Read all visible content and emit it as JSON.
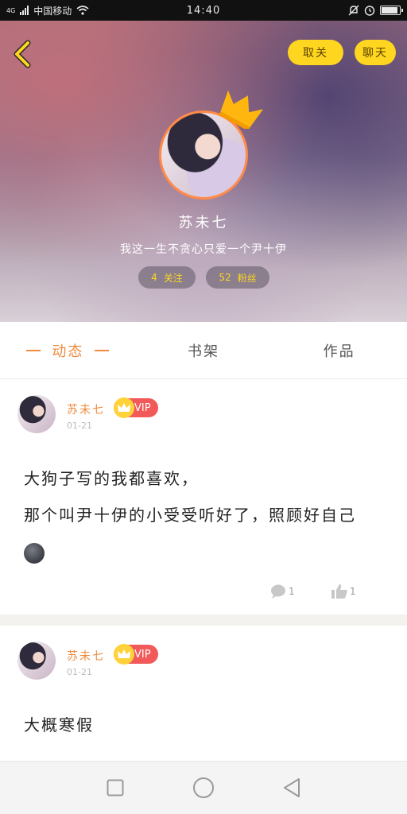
{
  "status_bar": {
    "network": "4G",
    "carrier": "中国移动",
    "time": "14:40",
    "icons": [
      "signal-icon",
      "wifi-icon",
      "mute-icon",
      "alarm-icon",
      "battery-icon"
    ]
  },
  "header": {
    "unfollow_label": "取关",
    "chat_label": "聊天",
    "nickname": "苏未七",
    "signature": "我这一生不贪心只爱一个尹十伊",
    "following_count": "4",
    "following_label": "关注",
    "fans_count": "52",
    "fans_label": "粉丝"
  },
  "tabs": [
    {
      "label": "动态",
      "active": true
    },
    {
      "label": "书架",
      "active": false
    },
    {
      "label": "作品",
      "active": false
    }
  ],
  "posts": [
    {
      "author": "苏未七",
      "badge": "VIP",
      "date": "01-21",
      "lines": [
        "大狗子写的我都喜欢，",
        "那个叫尹十伊的小受受听好了，照顾好自己"
      ],
      "comments": "1",
      "likes": "1"
    },
    {
      "author": "苏未七",
      "badge": "VIP",
      "date": "01-21",
      "lines": [
        "大概寒假"
      ]
    }
  ],
  "colors": {
    "accent": "#f08a3c",
    "button_yellow": "#ffd61f",
    "vip_red": "#f25a5a"
  }
}
